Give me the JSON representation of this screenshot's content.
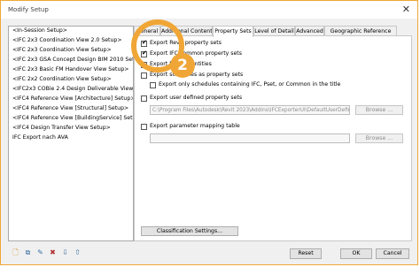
{
  "window": {
    "title": "Modify Setup",
    "close_glyph": "✕"
  },
  "setups": [
    "<In-Session Setup>",
    "<IFC 2x3 Coordination View 2.0 Setup>",
    "<IFC 2x3 Coordination View Setup>",
    "<IFC 2x3 GSA Concept Design BIM 2010 Setup>",
    "<IFC 2x3 Basic FM Handover View Setup>",
    "<IFC 2x2 Coordination View Setup>",
    "<IFC2x3 COBie 2.4 Design Deliverable View Setup>",
    "<IFC4 Reference View [Architecture] Setup>",
    "<IFC4 Reference View [Structural] Setup>",
    "<IFC4 Reference View [BuildingService] Setup>",
    "<IFC4 Design Transfer View Setup>",
    "IFC Export nach AVA"
  ],
  "tabs": [
    "General",
    "Additional Content",
    "Property Sets",
    "Level of Detail",
    "Advanced",
    "Geographic Reference"
  ],
  "active_tab": "Property Sets",
  "options": {
    "export_revit_psets": {
      "label": "Export Revit property sets",
      "checked": true
    },
    "export_ifc_common_psets": {
      "label": "Export IFC common property sets",
      "checked": true
    },
    "export_base_quantities": {
      "label": "Export base quantities",
      "checked": false
    },
    "export_schedules": {
      "label": "Export schedules as property sets",
      "checked": false
    },
    "export_schedules_only": {
      "label": "Export only schedules containing IFC, Pset, or Common in the title",
      "checked": false
    },
    "export_user_defined": {
      "label": "Export user defined property sets",
      "checked": false
    },
    "user_defined_path": "C:\\Program Files\\Autodesk\\Revit 2023\\AddIns\\IFCExporterUI\\DefaultUserDefinedParameterSets.txt",
    "export_param_mapping": {
      "label": "Export parameter mapping table",
      "checked": false
    },
    "param_mapping_path": ""
  },
  "buttons": {
    "browse1": "Browse ...",
    "browse2": "Browse ...",
    "classification": "Classification Settings...",
    "reset": "Reset",
    "ok": "OK",
    "cancel": "Cancel"
  },
  "callout": {
    "number": "2",
    "color": "#f0a636"
  }
}
